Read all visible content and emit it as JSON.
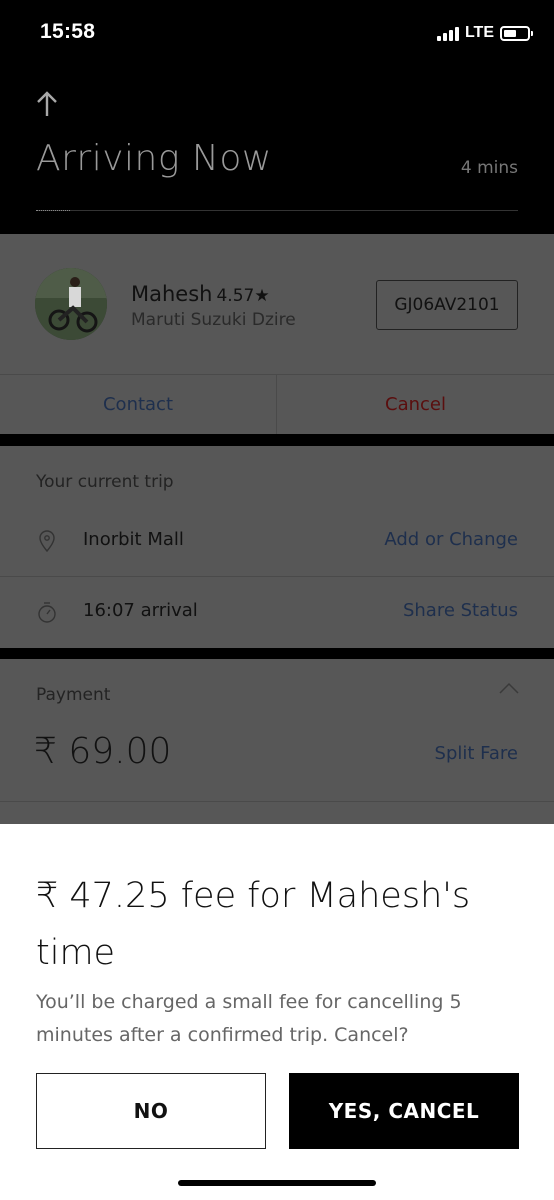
{
  "status_bar": {
    "time": "15:58",
    "network": "LTE",
    "battery_level": 0.55
  },
  "header": {
    "back_icon": "up-arrow-icon",
    "title": "Arriving Now",
    "eta": "4 mins"
  },
  "driver": {
    "name": "Mahesh",
    "rating": "4.57★",
    "car": "Maruti Suzuki Dzire",
    "plate": "GJ06AV2101",
    "contact_label": "Contact",
    "cancel_label": "Cancel"
  },
  "trip": {
    "header": "Your current trip",
    "destination": "Inorbit Mall",
    "destination_action": "Add or Change",
    "arrival": "16:07 arrival",
    "arrival_action": "Share Status"
  },
  "payment": {
    "label": "Payment",
    "fare": "₹ 69.00",
    "split_label": "Split Fare"
  },
  "dialog": {
    "title": "₹ 47.25 fee for Mahesh's time",
    "body": "You’ll be charged a small fee for cancelling 5 minutes after a confirmed trip. Cancel?",
    "no_label": "NO",
    "yes_label": "YES, CANCEL"
  },
  "colors": {
    "link_blue": "#1e2f4d",
    "cancel_red": "#5a0e0e",
    "overlay_gray": "#575757"
  }
}
